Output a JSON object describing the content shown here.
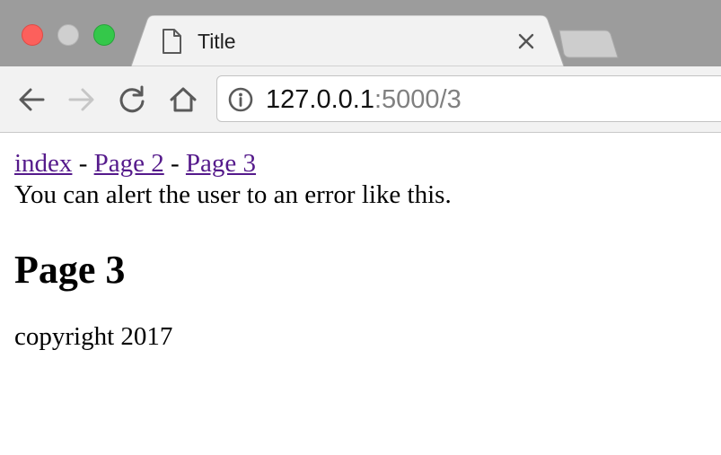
{
  "browser": {
    "tab": {
      "title": "Title"
    },
    "address_bar": {
      "host": "127.0.0.1",
      "rest": ":5000/3"
    }
  },
  "page": {
    "nav": {
      "links": [
        "index",
        "Page 2",
        "Page 3"
      ],
      "separator": " - "
    },
    "flash_message": "You can alert the user to an error like this.",
    "heading": "Page 3",
    "footer": "copyright 2017"
  }
}
